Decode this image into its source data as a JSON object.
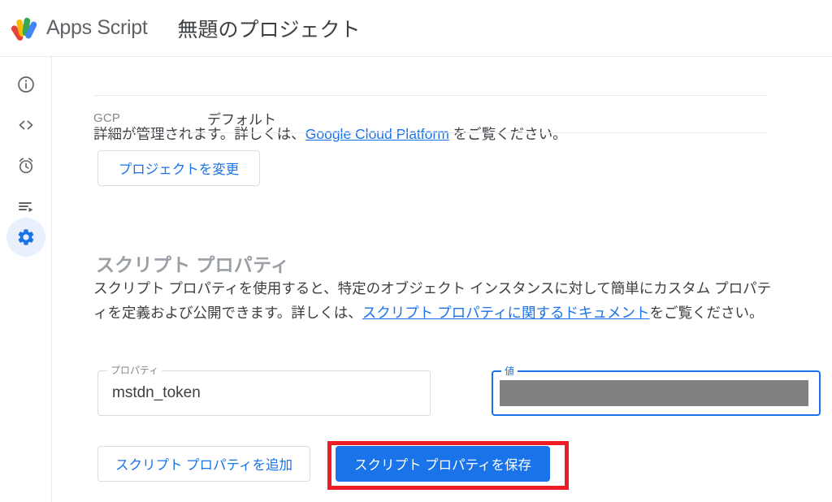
{
  "header": {
    "logo_icon": "apps-script-logo",
    "brand": "Apps Script",
    "project_title": "無題のプロジェクト"
  },
  "sidebar": {
    "items": [
      {
        "icon": "info-circle-icon",
        "name": "overview",
        "active": false
      },
      {
        "icon": "code-brackets-icon",
        "name": "editor",
        "active": false
      },
      {
        "icon": "alarm-clock-icon",
        "name": "triggers",
        "active": false
      },
      {
        "icon": "execution-log-icon",
        "name": "executions",
        "active": false
      },
      {
        "icon": "gear-icon",
        "name": "settings",
        "active": true
      }
    ]
  },
  "main": {
    "intro": {
      "text_before": "詳細が管理されます。詳しくは、",
      "link": "Google Cloud Platform",
      "text_after": " をご覧ください。"
    },
    "gcp_row": {
      "label": "GCP",
      "value": "デフォルト"
    },
    "change_project_button": "プロジェクトを変更",
    "script_properties": {
      "section_title": "スクリプト プロパティ",
      "description_before": "スクリプト プロパティを使用すると、特定のオブジェクト インスタンスに対して簡単にカスタム プロパティを定義および公開できます。詳しくは、",
      "description_link": "スクリプト プロパティに関するドキュメント",
      "description_after": "をご覧ください。",
      "property_field": {
        "label": "プロパティ",
        "value": "mstdn_token",
        "placeholder": ""
      },
      "value_field": {
        "label": "値",
        "value": "",
        "placeholder": "",
        "redacted": true,
        "focused": true
      },
      "delete_icon": "close-x-icon",
      "add_button": "スクリプト プロパティを追加",
      "save_button": "スクリプト プロパティを保存"
    }
  },
  "annotation": {
    "name": "red-highlight-box",
    "color": "#ee1c25",
    "target": "save-script-properties-button"
  },
  "colors": {
    "accent_blue": "#1a73e8",
    "link_blue": "#1a73e8",
    "text_primary": "#3c4043",
    "text_secondary": "#80868b",
    "border": "#dadce0",
    "divider": "#e8eaed",
    "active_nav_bg": "#e8f0fe",
    "redaction_gray": "#808080",
    "annotation_red": "#ee1c25"
  }
}
